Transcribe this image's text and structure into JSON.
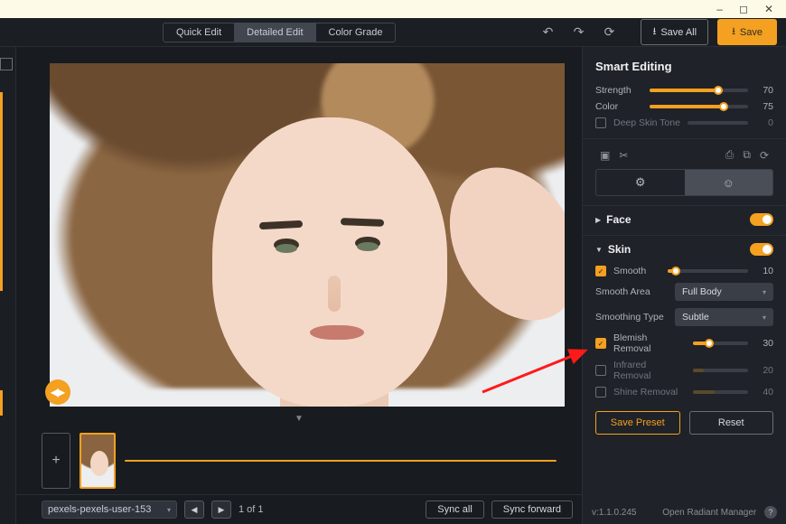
{
  "window": {
    "minimize": "–",
    "maximize": "◻",
    "close": "✕"
  },
  "tabs": {
    "quick": "Quick Edit",
    "detailed": "Detailed Edit",
    "color": "Color Grade",
    "active": "detailed"
  },
  "toolbar": {
    "save_all": "Save All",
    "save": "Save"
  },
  "panel_title": "Smart Editing",
  "sliders": {
    "strength": {
      "label": "Strength",
      "value": 70
    },
    "color": {
      "label": "Color",
      "value": 75
    },
    "deep": {
      "label": "Deep Skin Tone",
      "value": 0,
      "checked": false
    }
  },
  "sections": {
    "face": {
      "name": "Face",
      "expanded": false,
      "enabled": true
    },
    "skin": {
      "name": "Skin",
      "expanded": true,
      "enabled": true
    }
  },
  "skin": {
    "smooth": {
      "label": "Smooth",
      "value": 10,
      "checked": true
    },
    "area": {
      "label": "Smooth Area",
      "value": "Full Body"
    },
    "type": {
      "label": "Smoothing Type",
      "value": "Subtle"
    },
    "blemish": {
      "label": "Blemish Removal",
      "value": 30,
      "checked": true
    },
    "infrared": {
      "label": "Infrared Removal",
      "value": 20,
      "checked": false
    },
    "shine": {
      "label": "Shine Removal",
      "value": 40,
      "checked": false
    }
  },
  "buttons": {
    "save_preset": "Save Preset",
    "reset": "Reset"
  },
  "bottom": {
    "filename": "pexels-pexels-user-153",
    "page": "1 of 1",
    "sync_all": "Sync all",
    "sync_fwd": "Sync forward"
  },
  "footer": {
    "version": "v:1.1.0.245",
    "manager": "Open Radiant Manager"
  }
}
